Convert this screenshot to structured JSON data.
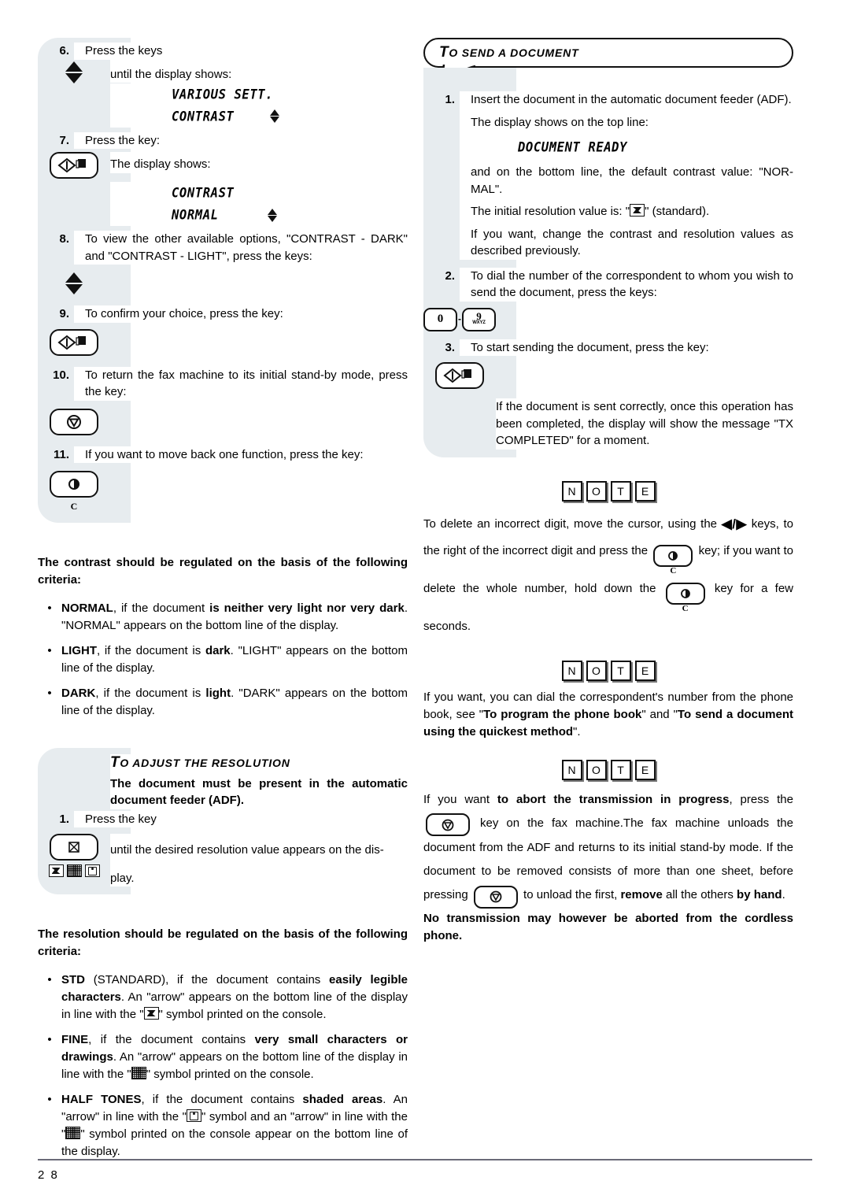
{
  "page": {
    "number": "2 8"
  },
  "left_column": {
    "steps": [
      {
        "num": "6.",
        "lines": [
          "Press the keys",
          "until the display shows:"
        ]
      },
      {
        "num": "7.",
        "lines": [
          "Press the key:",
          "The display shows:"
        ]
      },
      {
        "num": "8.",
        "lines": [
          "To view the other available options, \"CONTRAST - DARK\" and \"CONTRAST - LIGHT\", press the keys:"
        ]
      },
      {
        "num": "9.",
        "lines": [
          "To confirm your choice, press the key:"
        ]
      },
      {
        "num": "10.",
        "lines": [
          "To return the fax machine to its initial stand-by mode, press the key:"
        ]
      },
      {
        "num": "11.",
        "lines": [
          "If you want to move back one function, press the key:"
        ]
      }
    ],
    "display_1": {
      "top": "VARIOUS SETT.",
      "bottom": "CONTRAST"
    },
    "display_2": {
      "top": "CONTRAST",
      "bottom": "NORMAL"
    },
    "keys": {
      "updown": "up-down-arrows-key",
      "start": "start-key",
      "stop": "stop-key",
      "clear": "clear-key",
      "clear_label": "C",
      "resolution": "resolution-key",
      "resolution_symbols": "std-fine-halftone-symbols"
    },
    "contrast_intro": "The contrast should be regulated on the basis of the following criteria:",
    "contrast_bullets": [
      {
        "bold_lead": "NORMAL",
        "text_1": ", if the document ",
        "bold_mid": "is neither very light nor very dark",
        "text_2": ". \"NORMAL\" appears on the bottom line of the display."
      },
      {
        "bold_lead": "LIGHT",
        "text_1": ", if the document is ",
        "bold_mid": "dark",
        "text_2": ". \"LIGHT\" appears on the bottom line of the display."
      },
      {
        "bold_lead": "DARK",
        "text_1": ", if the document is ",
        "bold_mid": "light",
        "text_2": ". \"DARK\" appears on the bottom line of the display."
      }
    ],
    "resolution_callout": {
      "title_cap": "T",
      "title_rest": "O ADJUST THE RESOLUTION",
      "bold_note": "The document must be present in the automatic document feeder (ADF).",
      "step_num": "1.",
      "step_text_a": "Press the key",
      "step_text_b": "until the desired resolution value appears on the dis-",
      "step_text_c": "play."
    },
    "resolution_intro": "The resolution should be regulated on the basis of the following criteria:",
    "resolution_bullets": [
      {
        "bold_lead": "STD",
        "seg_1": " (STANDARD), if the document contains ",
        "bold_mid": "easily legible characters",
        "seg_2": ". An \"arrow\" appears on the bottom line of the display in line with the \"",
        "seg_3": "\" symbol printed on the console.",
        "symbol": "std-symbol"
      },
      {
        "bold_lead": "FINE",
        "seg_1": ", if the document contains ",
        "bold_mid": "very small characters or drawings",
        "seg_2": ". An \"arrow\" appears on the bottom line of the display in line with the \"",
        "seg_3": "\" symbol printed on the console.",
        "symbol": "fine-symbol"
      },
      {
        "bold_lead": "HALF TONES",
        "seg_1": ", if the document contains ",
        "bold_mid": "shaded areas",
        "seg_2": ". An \"arrow\" in line with the \"",
        "seg_3": "\" symbol and an \"arrow\" in line with the \"",
        "seg_4": "\" symbol printed on the console appear on the bottom line of the display.",
        "symbol_a": "halftone-symbol",
        "symbol_b": "fine-symbol"
      }
    ]
  },
  "right_column": {
    "callout": {
      "title_cap": "T",
      "title_rest": "O SEND A DOCUMENT"
    },
    "steps": [
      {
        "num": "1.",
        "l1": "Insert the document in the automatic document feeder (ADF).",
        "l2": "The display shows on the top line:",
        "display": "DOCUMENT READY",
        "l3": "and on the bottom line, the default contrast value: \"NOR-MAL\".",
        "l4_a": "The initial resolution value is: \"",
        "l4_b": "\" (standard).",
        "l5": "If you want, change the contrast and resolution values as described previously."
      },
      {
        "num": "2.",
        "l1": "To dial the number of the correspondent to whom you wish to send the document, press the keys:"
      },
      {
        "num": "3.",
        "l1": "To start sending the document, press the key:"
      }
    ],
    "keypad": {
      "zero": "0",
      "nine_digit": "9",
      "nine_letters": "WXYZ",
      "separator": "-"
    },
    "tail_text": "If the document is sent correctly, once this operation has been completed, the display will show the message \"TX COMPLETED\" for a moment.",
    "note_badge": [
      "N",
      "O",
      "T",
      "E"
    ],
    "note_1": {
      "seg_1": "To delete an incorrect digit, move the cursor, using the ",
      "arrows": "◀/▶",
      "seg_2": "keys, to the right of the incorrect digit and press the ",
      "key_label": "C",
      "seg_3": " key;",
      "seg_4": "if you want to delete the whole number, hold down the ",
      "seg_5": "key for a few seconds."
    },
    "note_2": {
      "seg_1": "If you want, you can dial the correspondent's number from the phone book, see \"",
      "bold_1": "To program the phone book",
      "seg_2": "\" and \"",
      "bold_2": "To send a document using the quickest method",
      "seg_3": "\"."
    },
    "note_3": {
      "seg_1": "If you want ",
      "bold_1": "to abort the transmission in progress",
      "seg_2": ", press the ",
      "seg_3": " key on the fax machine.The fax machine unloads the document from the ADF and returns to its initial stand-by mode.",
      "seg_4": "If the document to be removed consists of more than one sheet, before pressing ",
      "seg_5": " to unload the first, ",
      "bold_2": "remove",
      "seg_6": " all the others ",
      "bold_3": "by hand",
      "seg_7": ".",
      "bold_4": "No transmission may however be aborted from the cordless phone."
    }
  },
  "colors": {
    "rail": "#e7ecef",
    "ink": "#000000",
    "rule": "#6b6b78"
  }
}
